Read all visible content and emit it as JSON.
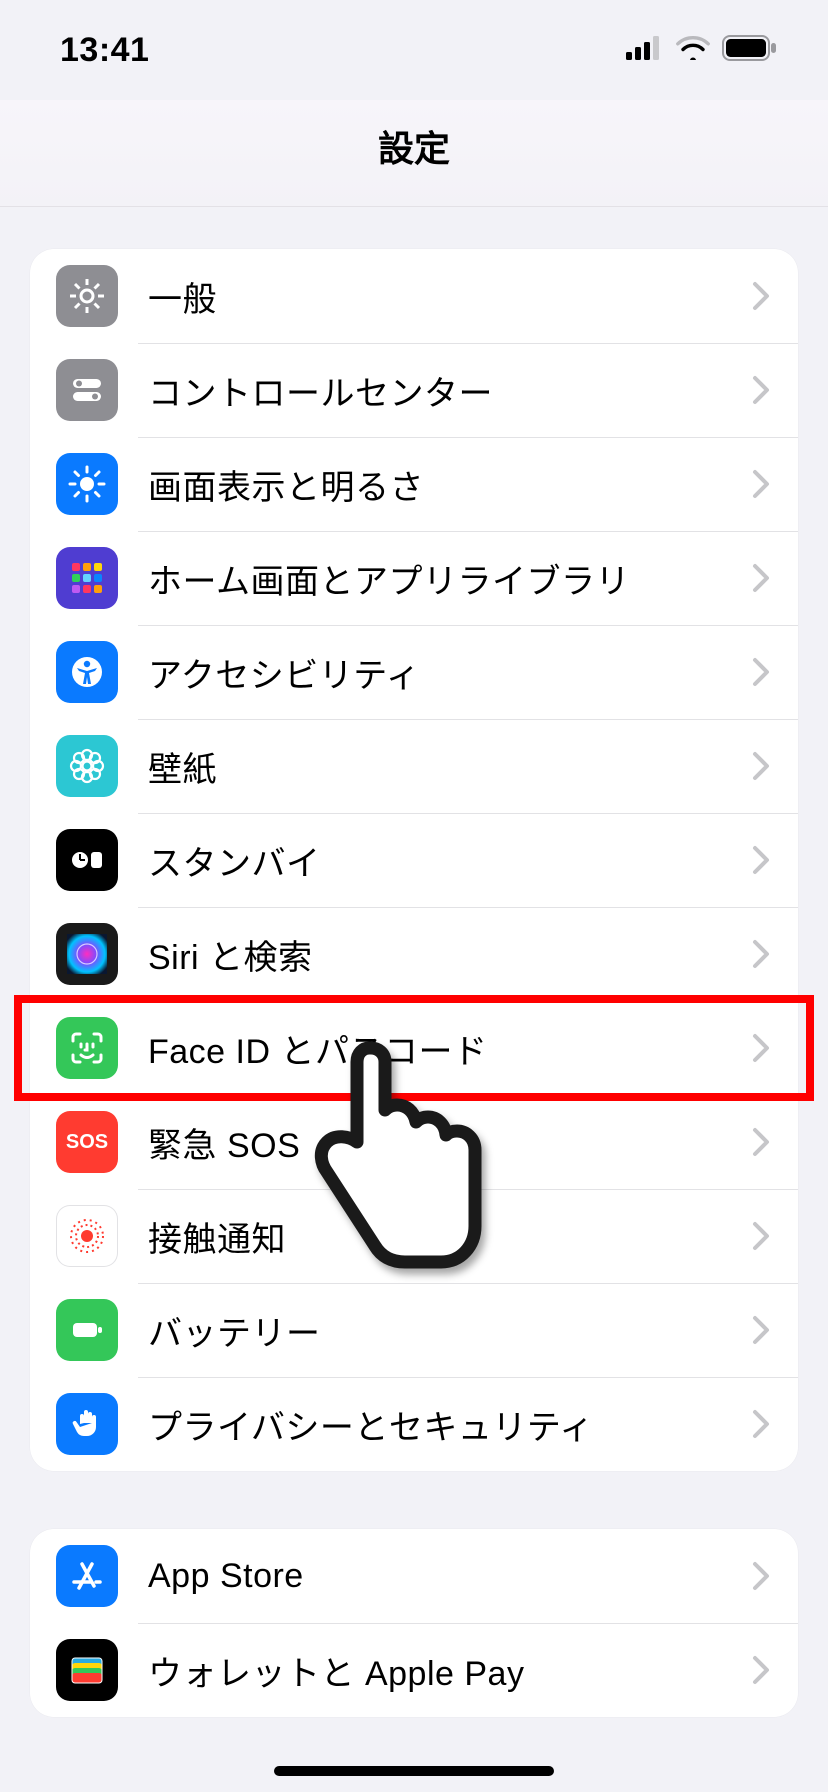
{
  "status": {
    "time": "13:41"
  },
  "title": "設定",
  "groups": [
    {
      "id": "group-a",
      "rows": [
        {
          "id": "general",
          "label": "一般",
          "icon": "gear-icon"
        },
        {
          "id": "control-center",
          "label": "コントロールセンター",
          "icon": "switches-icon"
        },
        {
          "id": "display",
          "label": "画面表示と明るさ",
          "icon": "brightness-icon"
        },
        {
          "id": "home-screen",
          "label": "ホーム画面とアプリライブラリ",
          "icon": "apps-grid-icon"
        },
        {
          "id": "accessibility",
          "label": "アクセシビリティ",
          "icon": "person-circle-icon"
        },
        {
          "id": "wallpaper",
          "label": "壁紙",
          "icon": "flower-icon"
        },
        {
          "id": "standby",
          "label": "スタンバイ",
          "icon": "clock-tile-icon"
        },
        {
          "id": "siri",
          "label": "Siri と検索",
          "icon": "siri-icon"
        },
        {
          "id": "faceid",
          "label": "Face ID とパスコード",
          "icon": "faceid-icon",
          "highlighted": true
        },
        {
          "id": "sos",
          "label": "緊急 SOS",
          "icon": "sos-icon",
          "text": "SOS"
        },
        {
          "id": "exposure",
          "label": "接触通知",
          "icon": "exposure-icon"
        },
        {
          "id": "battery",
          "label": "バッテリー",
          "icon": "battery-icon"
        },
        {
          "id": "privacy",
          "label": "プライバシーとセキュリティ",
          "icon": "hand-icon"
        }
      ]
    },
    {
      "id": "group-b",
      "rows": [
        {
          "id": "appstore",
          "label": "App Store",
          "icon": "appstore-icon"
        },
        {
          "id": "wallet",
          "label": "ウォレットと Apple Pay",
          "icon": "wallet-icon"
        }
      ]
    }
  ],
  "colors": {
    "gear-icon": "#8e8e93",
    "switches-icon": "#8e8e93",
    "brightness-icon": "#0a7aff",
    "apps-grid-icon": "#4f3dd1",
    "person-circle-icon": "#0a7aff",
    "flower-icon": "#2cc7d3",
    "clock-tile-icon": "#000000",
    "siri-icon": "#1a1a1a",
    "faceid-icon": "#34c759",
    "sos-icon": "#ff3b30",
    "exposure-icon": "#ffffff",
    "battery-icon": "#34c759",
    "hand-icon": "#0a7aff",
    "appstore-icon": "#0a7aff",
    "wallet-icon": "#000000"
  }
}
